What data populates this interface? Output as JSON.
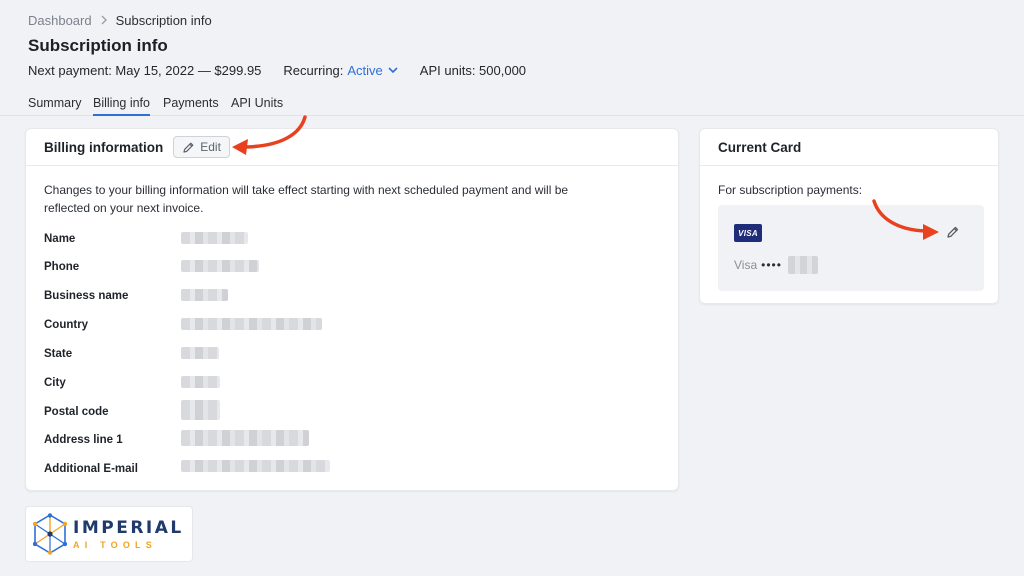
{
  "breadcrumb": {
    "parent": "Dashboard",
    "current": "Subscription info"
  },
  "page": {
    "title": "Subscription info"
  },
  "meta": {
    "next_payment": "Next payment: May 15, 2022 — $299.95",
    "recurring_label": "Recurring:",
    "recurring_value": "Active",
    "api_units": "API units: 500,000"
  },
  "tabs": [
    {
      "label": "Summary",
      "active": false
    },
    {
      "label": "Billing info",
      "active": true
    },
    {
      "label": "Payments",
      "active": false
    },
    {
      "label": "API Units",
      "active": false
    }
  ],
  "billing": {
    "title": "Billing information",
    "edit_label": "Edit",
    "description": "Changes to your billing information will take effect starting with next scheduled payment and will be reflected on your next invoice.",
    "fields": [
      {
        "label": "Name"
      },
      {
        "label": "Phone"
      },
      {
        "label": "Business name"
      },
      {
        "label": "Country"
      },
      {
        "label": "State"
      },
      {
        "label": "City"
      },
      {
        "label": "Postal code"
      },
      {
        "label": "Address line 1"
      },
      {
        "label": "Additional E-mail"
      }
    ]
  },
  "current_card": {
    "title": "Current Card",
    "subtitle": "For subscription payments:",
    "brand_badge": "VISA",
    "brand_name": "Visa",
    "masked_digits": "••••"
  },
  "logo": {
    "main": "IMPERIAL",
    "sub": "AI TOOLS"
  },
  "colors": {
    "accent": "#2f6fd6",
    "annotation_arrow": "#e8411f",
    "visa_blue": "#1f2c78",
    "logo_navy": "#1f3a6b",
    "logo_orange": "#f2a322"
  },
  "icons": {
    "breadcrumb_separator": "chevron-right-icon",
    "recurring_dropdown": "chevron-down-icon",
    "edit": "pencil-icon",
    "card_edit": "pencil-icon",
    "logo": "hexagon-network-icon"
  }
}
